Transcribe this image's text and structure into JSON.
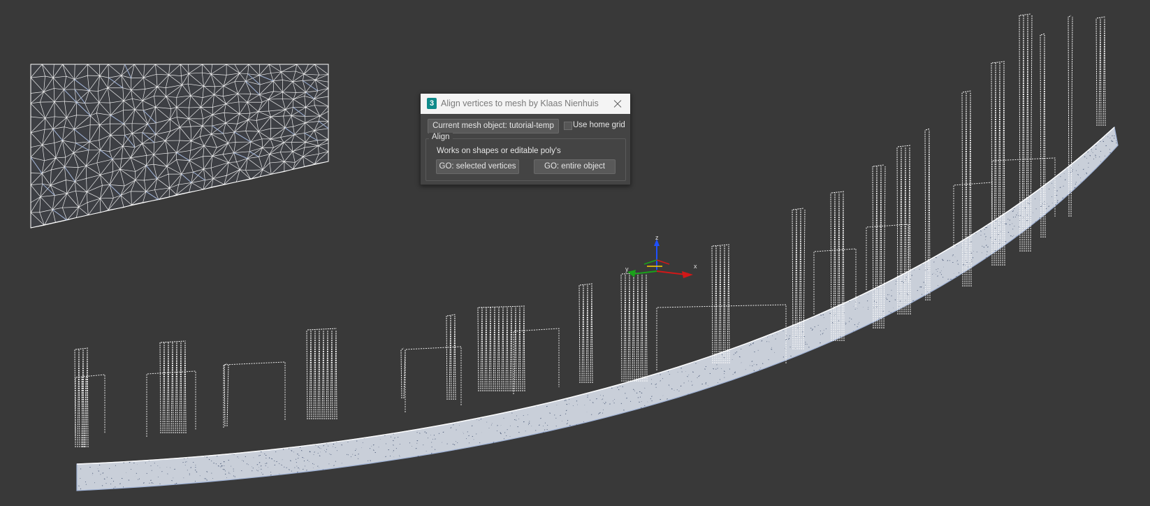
{
  "dialog": {
    "icon_label": "3",
    "title": "Align vertices to mesh by Klaas Nienhuis",
    "close_icon": "close-icon",
    "mesh_button_label": "Current mesh object: tutorial-temp",
    "use_home_grid_label": "Use home grid",
    "use_home_grid_checked": false,
    "align_group_label": "Align",
    "info_text": "Works on shapes or editable poly's",
    "go_selected_label": "GO: selected vertices",
    "go_entire_label": "GO: entire object"
  },
  "viewport": {
    "background": "#393939",
    "gizmo": {
      "z_label": "z",
      "x_label": "x",
      "y_label": "y"
    }
  },
  "colors": {
    "accent_icon": "#0f8a8a",
    "wire": "#ffffff",
    "mesh_blue": "#9fb2d6"
  }
}
